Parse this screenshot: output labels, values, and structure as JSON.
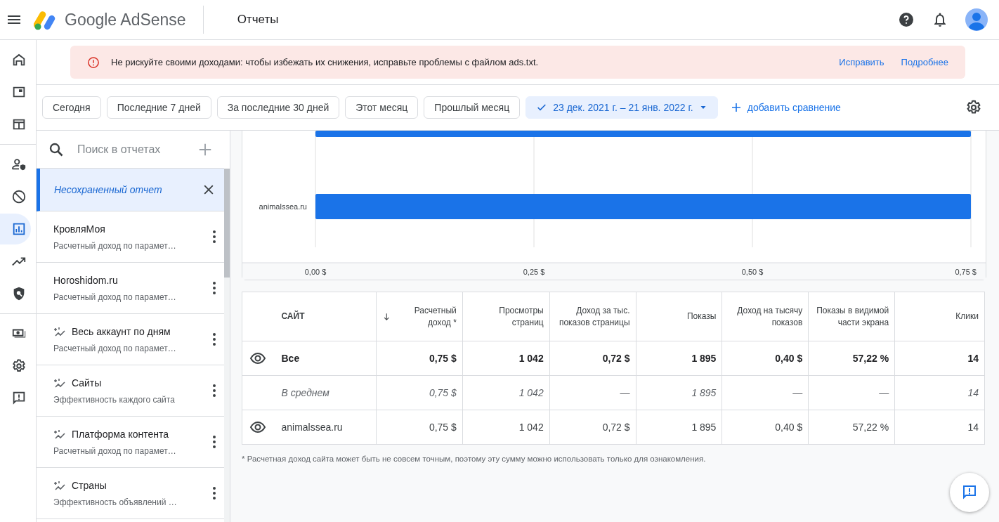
{
  "header": {
    "product": "Google AdSense",
    "page_title": "Отчеты"
  },
  "rail_groups": [
    [
      {
        "selected": false
      },
      {
        "selected": false
      },
      {
        "selected": false
      }
    ],
    [
      {
        "selected": false
      },
      {
        "selected": false
      },
      {
        "selected": true
      },
      {
        "selected": false
      },
      {
        "selected": false
      }
    ],
    [
      {
        "selected": false
      },
      {
        "selected": false
      },
      {
        "selected": false
      }
    ]
  ],
  "alert": {
    "text": "Не рискуйте своими доходами: чтобы избежать их снижения, исправьте проблемы с файлом ads.txt.",
    "actions": [
      "Исправить",
      "Подробнее"
    ]
  },
  "date_filters": [
    {
      "label": "Сегодня",
      "selected": false
    },
    {
      "label": "Последние 7 дней",
      "selected": false
    },
    {
      "label": "За последние 30 дней",
      "selected": false
    },
    {
      "label": "Этот месяц",
      "selected": false
    },
    {
      "label": "Прошлый месяц",
      "selected": false
    },
    {
      "label": "23 дек. 2021 г. – 21 янв. 2022 г.",
      "selected": true
    }
  ],
  "add_comparison": "добавить сравнение",
  "reports_panel": {
    "search": {
      "placeholder": "Поиск в отчетах"
    },
    "items": [
      {
        "kind": "unsaved",
        "title": "Несохраненный отчет",
        "selected": true
      },
      {
        "kind": "saved",
        "title": "КровляМоя",
        "subtitle": "Расчетный доход по парамет…",
        "suggested": false,
        "selected": false
      },
      {
        "kind": "saved",
        "title": "Horoshidom.ru",
        "subtitle": "Расчетный доход по парамет…",
        "suggested": false,
        "selected": false
      },
      {
        "kind": "saved",
        "title": "Весь аккаунт по дням",
        "subtitle": "Расчетный доход по парамет…",
        "suggested": true,
        "selected": false
      },
      {
        "kind": "saved",
        "title": "Сайты",
        "subtitle": "Эффективность каждого сайта",
        "suggested": true,
        "selected": false
      },
      {
        "kind": "saved",
        "title": "Платформа контента",
        "subtitle": "Расчетный доход по парамет…",
        "suggested": true,
        "selected": false
      },
      {
        "kind": "saved",
        "title": "Страны",
        "subtitle": "Эффективность объявлений …",
        "suggested": true,
        "selected": false
      }
    ]
  },
  "chart": {
    "partial_bar_above": true,
    "chart_data": {
      "type": "bar",
      "orientation": "horizontal",
      "categories": [
        "animalssea.ru"
      ],
      "series": [
        {
          "color": "#1a73e8",
          "values": [
            0.75
          ]
        }
      ],
      "xlim": [
        0,
        0.75
      ],
      "xticks": [
        {
          "value": 0,
          "label": "0,00 $"
        },
        {
          "value": 0.25,
          "label": "0,25 $"
        },
        {
          "value": 0.5,
          "label": "0,50 $"
        },
        {
          "value": 0.75,
          "label": "0,75 $"
        }
      ]
    }
  },
  "table": {
    "columns": [
      {
        "label": "САЙТ",
        "sorted": false
      },
      {
        "label": "Расчетный доход *",
        "sorted": true
      },
      {
        "label": "Просмотры страниц",
        "sorted": false
      },
      {
        "label": "Доход за тыс. показов страницы",
        "sorted": false
      },
      {
        "label": "Показы",
        "sorted": false
      },
      {
        "label": "Доход на тысячу показов",
        "sorted": false
      },
      {
        "label": "Показы в видимой части экрана",
        "sorted": false
      },
      {
        "label": "Клики",
        "sorted": false
      }
    ],
    "rows": [
      {
        "kind": "total",
        "cells": [
          "Все",
          "0,75 $",
          "1 042",
          "0,72 $",
          "1 895",
          "0,40 $",
          "57,22 %",
          "14"
        ]
      },
      {
        "kind": "average",
        "cells": [
          "В среднем",
          "0,75 $",
          "1 042",
          "—",
          "1 895",
          "—",
          "—",
          "14"
        ]
      },
      {
        "kind": "site",
        "cells": [
          "animalssea.ru",
          "0,75 $",
          "1 042",
          "0,72 $",
          "1 895",
          "0,40 $",
          "57,22 %",
          "14"
        ]
      }
    ]
  },
  "footnote": "* Расчетная доход сайта может быть не совсем точным, поэтому эту сумму можно использовать только для ознакомления."
}
